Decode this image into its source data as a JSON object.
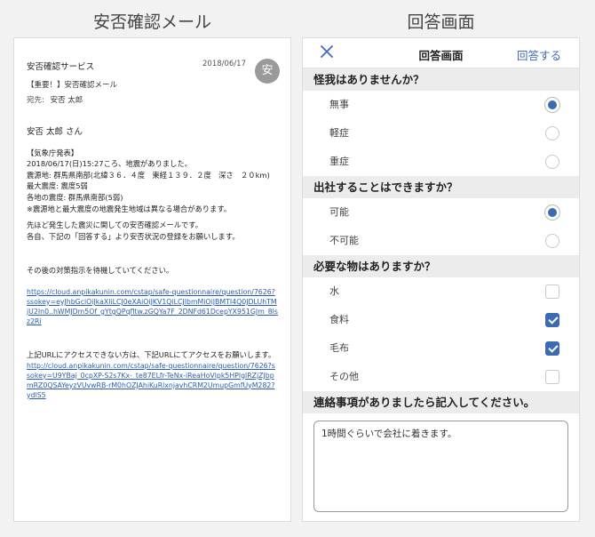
{
  "headings": {
    "mail": "安否確認メール",
    "form": "回答画面"
  },
  "mail": {
    "sender": "安否確認サービス",
    "date": "2018/06/17",
    "avatar": "安",
    "subject": "【重要！】安否確認メール",
    "to_label": "宛先:",
    "to_name": "安否 太郎",
    "salutation": "安否 太郎 さん",
    "p1": "【気象庁発表】\n2018/06/17(日)15:27ころ、地震がありました。\n震源地: 群馬県南部(北緯３６．４度　東経１３９．２度　深さ　２０km)\n最大震度: 震度5弱\n各地の震度: 群馬県南部(5弱)\n※震源地と最大震度の地震発生地域は異なる場合があります。",
    "p2": "先ほど発生した震災に関しての安否確認メールです。\n各自、下記の「回答する」より安否状況の登録をお願いします。",
    "p3": "その後の対策指示を待機していてください。",
    "link1": "https://cloud.anpikakunin.com/cstap/safe-questionnaire/question/7626?ssokey=eyJhbGciOiJkaXliLCJ0eXAiOiJKV1QiLCJIbmMiOiJBMTI4Q0JDLUhTMjU2In0..hWMJDm5Of_gYtgQPqfltw.zGQYa7F_2DNFd61DcepYX951GJm_8lsz2Ri",
    "p4": "上記URLにアクセスできない方は、下記URLにてアクセスをお願いします。",
    "link2": "http://cloud.anpikakunin.com/cstap/safe-questionnaire/question/7626?ssokey=U9YBaj_0cpXP-S2s7Kx-_te87ELfr-TeNx-iReaHoVlpk5HPlglRZjZJbpmRZ0QSAYeyzVUvwRB-rM0hOZJAhiKuRlxnjavhCRM2UmupGmfUyM282?ydlS5"
  },
  "form": {
    "close_icon": "close-x-icon",
    "title": "回答画面",
    "submit_label": "回答する",
    "accent": "#3d6bb3",
    "sections": [
      {
        "title": "怪我はありませんか？",
        "type": "radio",
        "options": [
          {
            "label": "無事",
            "checked": true
          },
          {
            "label": "軽症",
            "checked": false
          },
          {
            "label": "重症",
            "checked": false
          }
        ]
      },
      {
        "title": "出社することはできますか？",
        "type": "radio",
        "options": [
          {
            "label": "可能",
            "checked": true
          },
          {
            "label": "不可能",
            "checked": false
          }
        ]
      },
      {
        "title": "必要な物はありますか？",
        "type": "checkbox",
        "options": [
          {
            "label": "水",
            "checked": false
          },
          {
            "label": "食料",
            "checked": true
          },
          {
            "label": "毛布",
            "checked": true
          },
          {
            "label": "その他",
            "checked": false
          }
        ]
      }
    ],
    "note_title": "連絡事項がありましたら記入してください。",
    "note_value": "1時間ぐらいで会社に着きます。"
  }
}
